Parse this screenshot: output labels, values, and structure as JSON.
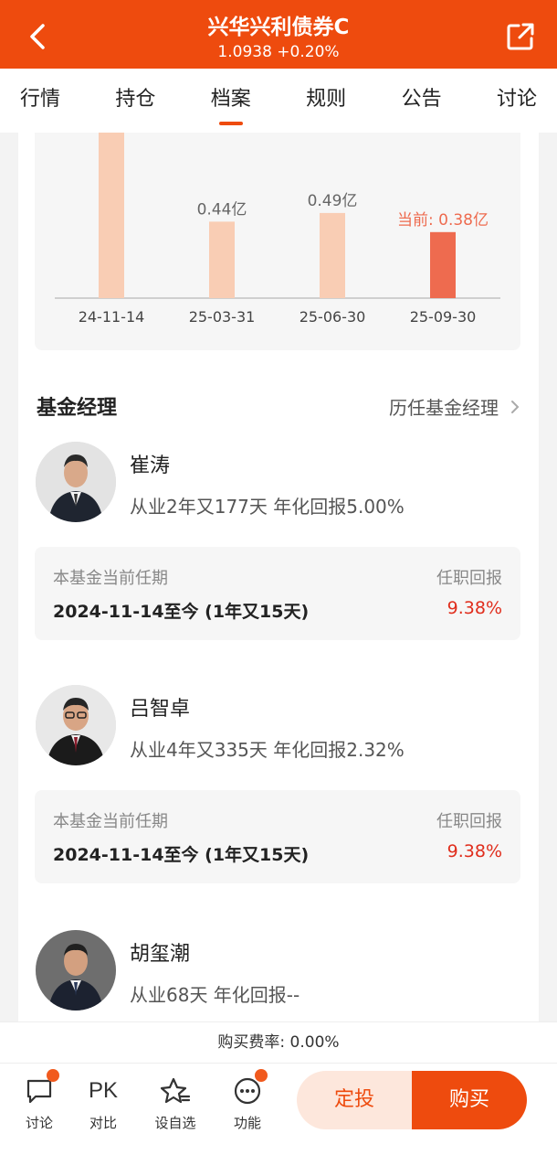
{
  "header": {
    "title": "兴华兴利债券C",
    "subtitle": "1.0938 +0.20%"
  },
  "tabs": [
    {
      "label": "行情"
    },
    {
      "label": "持仓"
    },
    {
      "label": "档案"
    },
    {
      "label": "规则"
    },
    {
      "label": "公告"
    },
    {
      "label": "讨论"
    }
  ],
  "chart_data": {
    "type": "bar",
    "categories": [
      "24-11-14",
      "25-03-31",
      "25-06-30",
      "25-09-30"
    ],
    "values": [
      null,
      0.44,
      0.49,
      0.38
    ],
    "data_labels": [
      "",
      "0.44亿",
      "0.49亿",
      "当前: 0.38亿"
    ],
    "colors": [
      "#f9cdb4",
      "#f9cdb4",
      "#f9cdb4",
      "#ee6b4f"
    ],
    "highlight_color": "#ee6b4f"
  },
  "managers_section": {
    "title": "基金经理",
    "history_link": "历任基金经理"
  },
  "managers": [
    {
      "name": "崔涛",
      "experience": "从业2年又177天 年化回报5.00%",
      "term_label": "本基金当前任期",
      "term_return_label": "任职回报",
      "term_dates": "2024-11-14至今 (1年又15天)",
      "term_return": "9.38%"
    },
    {
      "name": "吕智卓",
      "experience": "从业4年又335天 年化回报2.32%",
      "term_label": "本基金当前任期",
      "term_return_label": "任职回报",
      "term_dates": "2024-11-14至今 (1年又15天)",
      "term_return": "9.38%"
    },
    {
      "name": "胡玺潮",
      "experience": "从业68天 年化回报--"
    }
  ],
  "fee": {
    "text": "购买费率: 0.00%"
  },
  "bottom_bar": {
    "items": [
      {
        "label": "讨论",
        "icon": "chat-icon"
      },
      {
        "label": "对比",
        "icon": "pk-icon",
        "glyph": "PK"
      },
      {
        "label": "设自选",
        "icon": "star-icon"
      },
      {
        "label": "功能",
        "icon": "more-icon"
      }
    ],
    "dingtou": "定投",
    "buy": "购买"
  },
  "colors": {
    "brand": "#ee4b0e",
    "positive": "#e02d1c"
  }
}
